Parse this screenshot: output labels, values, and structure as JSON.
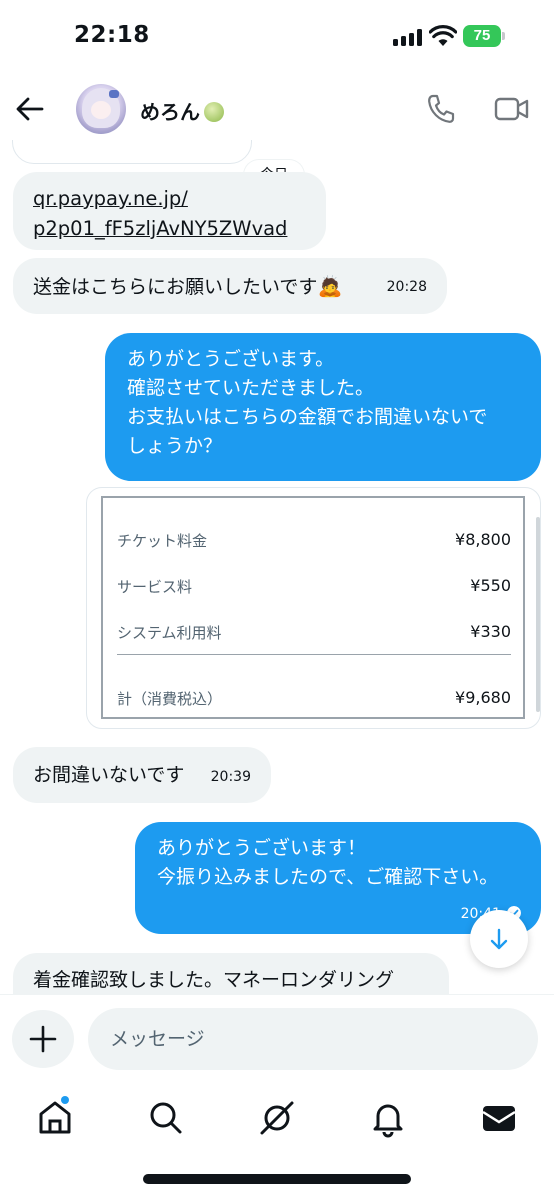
{
  "status_bar": {
    "time": "22:18",
    "battery": "75"
  },
  "header": {
    "contact_name": "めろん"
  },
  "messages": {
    "partial_bubble_top": "",
    "today_label": "今日",
    "link_line1": "qr.paypay.ne.jp/",
    "link_line2": "p2p01_fF5zljAvNY5ZWvad",
    "msg_request_text": "送金はこちらにお願いしたいです",
    "msg_request_emoji": "🙇",
    "msg_request_time": "20:28",
    "out1_line1": "ありがとうございます。",
    "out1_line2": "確認させていただきました。",
    "out1_line3": "お支払いはこちらの金額でお間違いないで",
    "out1_line4": "しょうか？",
    "price_card": {
      "rows": [
        {
          "label": "チケット料金",
          "amount": "¥8,800"
        },
        {
          "label": "サービス料",
          "amount": "¥550"
        },
        {
          "label": "システム利用料",
          "amount": "¥330"
        }
      ],
      "total_label": "計（消費税込）",
      "total_amount": "¥9,680"
    },
    "msg_confirm_text": "お間違いないです",
    "msg_confirm_time": "20:39",
    "out2_line1": "ありがとうございます！",
    "out2_line2": "今振り込みましたので、ご確認下さい。",
    "out2_time": "20:41",
    "msg_last_text": "着金確認致しました。マネーロンダリング"
  },
  "composer": {
    "placeholder": "メッセージ"
  },
  "nav": {
    "items": [
      "home-icon",
      "search-icon",
      "grok-icon",
      "notifications-icon",
      "messages-icon"
    ],
    "accent": "#1d9bf0"
  },
  "colors": {
    "outgoing_bubble": "#1d9bf0",
    "incoming_bubble": "#eff3f4",
    "battery": "#34c759"
  }
}
